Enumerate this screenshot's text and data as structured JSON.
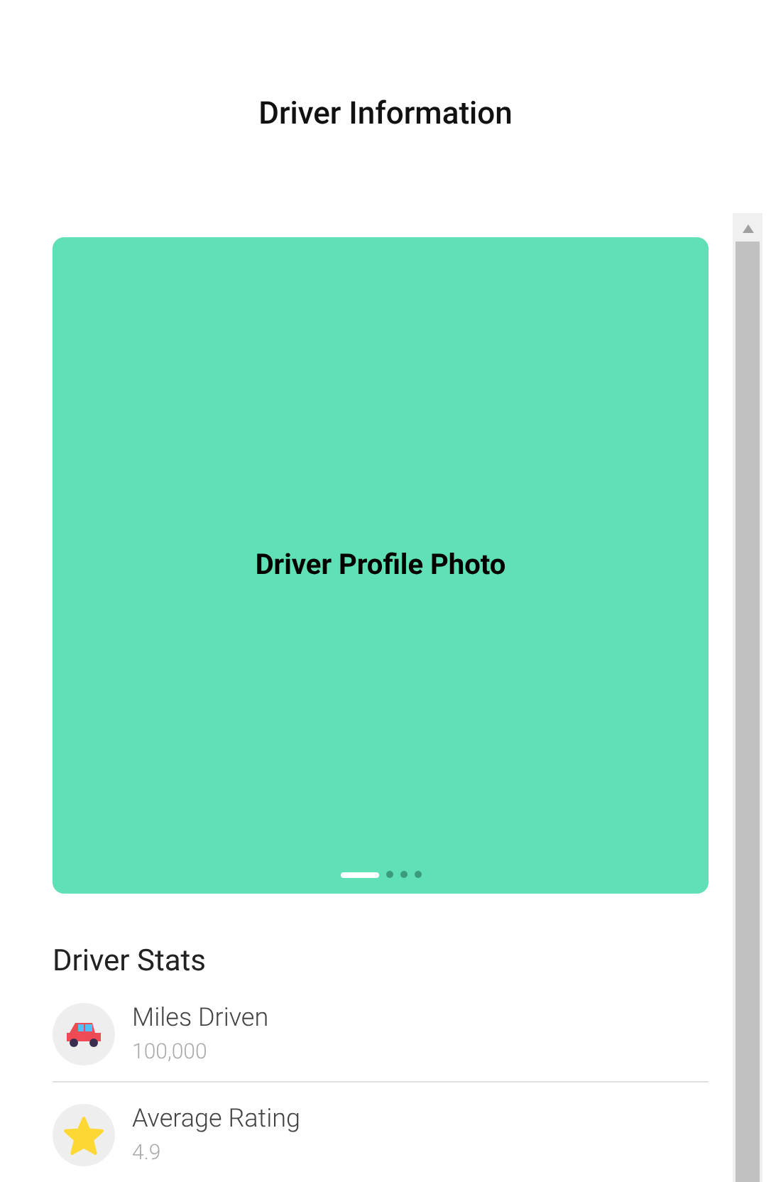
{
  "title": "Driver Information",
  "carousel": {
    "caption": "Driver Profile Photo",
    "pages": [
      {
        "selected": true
      },
      {
        "selected": false
      },
      {
        "selected": false
      },
      {
        "selected": false
      }
    ]
  },
  "stats": {
    "heading": "Driver Stats",
    "items": [
      {
        "kind": "car",
        "label": "Miles Driven",
        "value": "100,000"
      },
      {
        "kind": "star",
        "label": "Average Rating",
        "value": "4.9"
      }
    ]
  }
}
